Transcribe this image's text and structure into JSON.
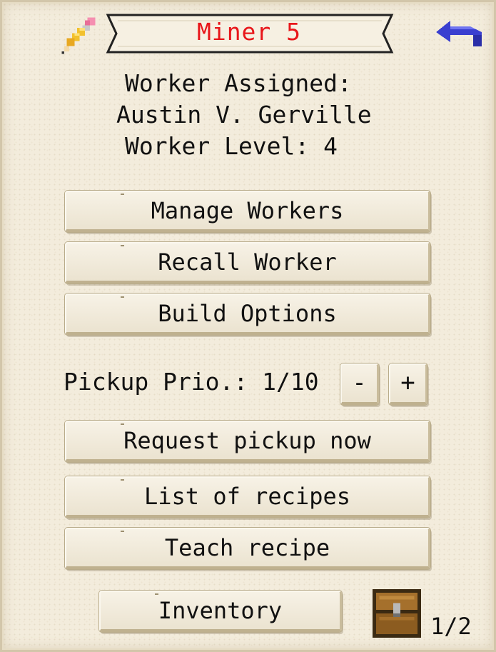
{
  "header": {
    "title": "Miner 5",
    "title_color": "#e8161a",
    "edit_icon": "pencil-icon",
    "back_icon": "back-arrow-icon"
  },
  "worker": {
    "assigned_label": "Worker Assigned:",
    "name": "Austin V. Gerville",
    "level_label": "Worker Level: 4"
  },
  "buttons": {
    "manage_workers": "Manage Workers",
    "recall_worker": "Recall Worker",
    "build_options": "Build Options",
    "request_pickup": "Request pickup now",
    "list_recipes": "List of recipes",
    "teach_recipe": "Teach recipe",
    "inventory": "Inventory"
  },
  "pickup": {
    "label": "Pickup Prio.: 1/10",
    "decrease": "-",
    "increase": "+"
  },
  "footer": {
    "chest_icon": "chest-icon",
    "page": "1/2"
  }
}
